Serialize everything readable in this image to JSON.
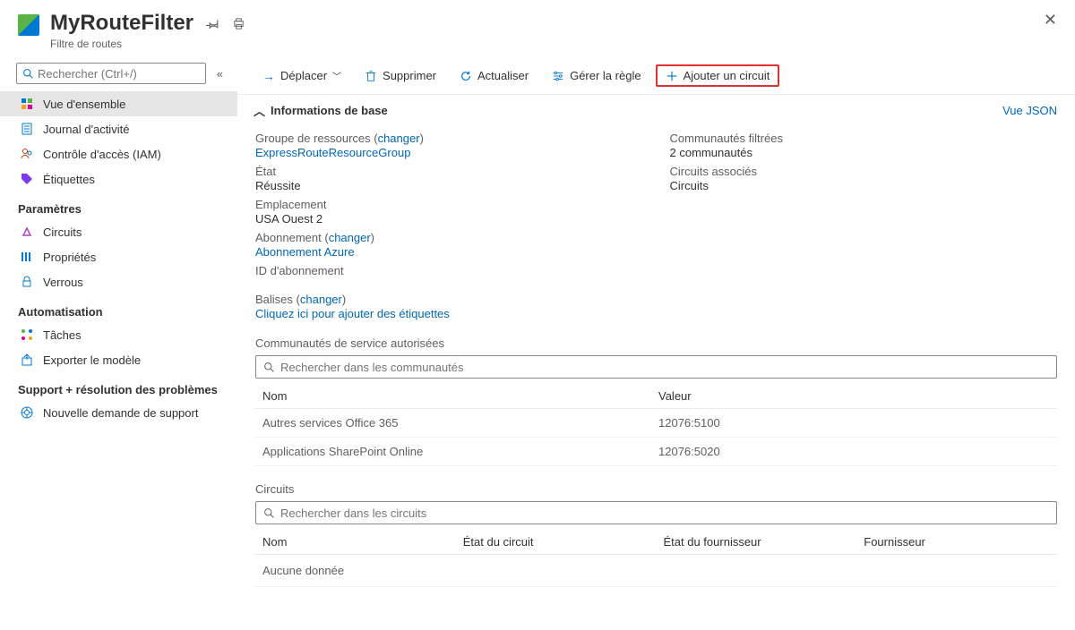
{
  "header": {
    "title": "MyRouteFilter",
    "subtitle": "Filtre de routes"
  },
  "sidebar": {
    "search_placeholder": "Rechercher (Ctrl+/)",
    "items_top": [
      {
        "label": "Vue d'ensemble",
        "icon": "overview",
        "active": true
      },
      {
        "label": "Journal d'activité",
        "icon": "activity"
      },
      {
        "label": "Contrôle d'accès (IAM)",
        "icon": "iam"
      },
      {
        "label": "Étiquettes",
        "icon": "tags"
      }
    ],
    "section_settings": "Paramètres",
    "items_settings": [
      {
        "label": "Circuits",
        "icon": "circuits"
      },
      {
        "label": "Propriétés",
        "icon": "properties"
      },
      {
        "label": "Verrous",
        "icon": "locks"
      }
    ],
    "section_automation": "Automatisation",
    "items_automation": [
      {
        "label": "Tâches",
        "icon": "tasks"
      },
      {
        "label": "Exporter le modèle",
        "icon": "export"
      }
    ],
    "section_support": "Support + résolution des problèmes",
    "items_support": [
      {
        "label": "Nouvelle demande de support",
        "icon": "support"
      }
    ]
  },
  "toolbar": {
    "move": "Déplacer",
    "delete": "Supprimer",
    "refresh": "Actualiser",
    "manage_rule": "Gérer la règle",
    "add_circuit": "Ajouter un circuit"
  },
  "essentials": {
    "section_label": "Informations de base",
    "view_json": "Vue JSON",
    "change": "changer",
    "left": {
      "resource_group_label": "Groupe de ressources",
      "resource_group_value": "ExpressRouteResourceGroup",
      "state_label": "État",
      "state_value": "Réussite",
      "location_label": "Emplacement",
      "location_value": "USA Ouest 2",
      "subscription_label": "Abonnement",
      "subscription_value": "Abonnement Azure",
      "subscription_id_label": "ID d'abonnement",
      "subscription_id_value": ""
    },
    "right": {
      "filtered_label": "Communautés filtrées",
      "filtered_value": "2 communautés",
      "assoc_label": "Circuits associés",
      "assoc_value": "Circuits"
    },
    "tags_label": "Balises",
    "tags_link": "Cliquez ici pour ajouter des étiquettes"
  },
  "communities": {
    "title": "Communautés de service autorisées",
    "search_placeholder": "Rechercher dans les communautés",
    "col_name": "Nom",
    "col_value": "Valeur",
    "rows": [
      {
        "name": "Autres services Office 365",
        "value": "12076:5100"
      },
      {
        "name": "Applications SharePoint Online",
        "value": "12076:5020"
      }
    ]
  },
  "circuits": {
    "title": "Circuits",
    "search_placeholder": "Rechercher dans les circuits",
    "col_name": "Nom",
    "col_state": "État du circuit",
    "col_provider_state": "État du fournisseur",
    "col_provider": "Fournisseur",
    "no_data": "Aucune donnée"
  }
}
